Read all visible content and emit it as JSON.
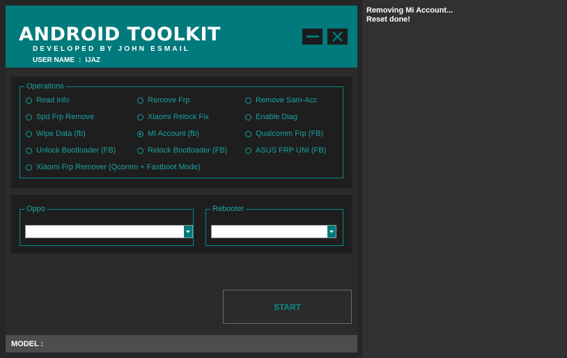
{
  "header": {
    "title": "ANDROID TOOLKIT",
    "subtitle": "DEVELOPED BY JOHN ESMAIL",
    "user_label": "USER NAME",
    "user_sep": ":",
    "user_name": "IJAZ"
  },
  "operations": {
    "legend": "Operations",
    "options": [
      {
        "label": "Read Info",
        "checked": false
      },
      {
        "label": "Remove Frp",
        "checked": false
      },
      {
        "label": "Remove Sam-Acc",
        "checked": false
      },
      {
        "label": "Spd Frp Remove",
        "checked": false
      },
      {
        "label": "Xiaomi Relock Fix",
        "checked": false
      },
      {
        "label": "Enable Diag",
        "checked": false
      },
      {
        "label": "Wipe Data (fb)",
        "checked": false
      },
      {
        "label": "MI Account (fb)",
        "checked": true
      },
      {
        "label": "Qualcomm Frp (FB)",
        "checked": false
      },
      {
        "label": "Unlock Bootloader (FB)",
        "checked": false
      },
      {
        "label": "Relock Bootloader (FB)",
        "checked": false
      },
      {
        "label": "ASUS FRP UNI (FB)",
        "checked": false
      },
      {
        "label": "Xiaomi Frp Remover (Qcomm + Fastboot Mode)",
        "checked": false
      }
    ]
  },
  "oppo": {
    "legend": "Oppo",
    "value": ""
  },
  "rebooter": {
    "legend": "Rebooter",
    "value": ""
  },
  "start_label": "START",
  "status": {
    "model_label": "MODEL :"
  },
  "log": {
    "lines": [
      "Removing Mi Account...",
      "Reset done!"
    ]
  },
  "colors": {
    "header": "#007a7c",
    "accent": "#1aa2a2",
    "panel": "#1e1e1e",
    "background": "#2b2b2b"
  },
  "icons": {
    "minimize": "minimize-icon",
    "close": "close-icon",
    "dropdown": "chevron-down-icon"
  }
}
